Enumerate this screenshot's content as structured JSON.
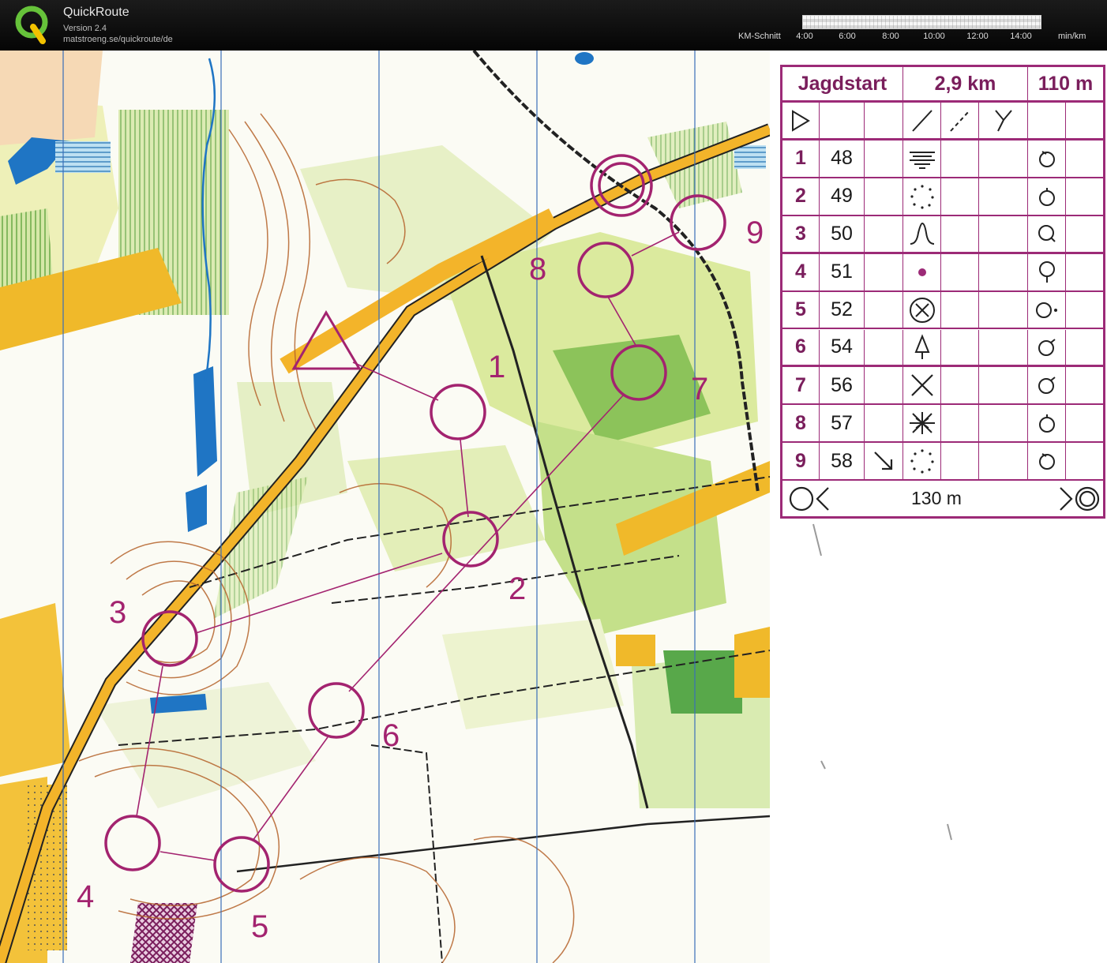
{
  "header": {
    "app_name": "QuickRoute",
    "version": "Version 2.4",
    "url": "matstroeng.se/quickroute/de",
    "pace_label": "KM-Schnitt",
    "pace_ticks": [
      "4:00",
      "6:00",
      "8:00",
      "10:00",
      "12:00",
      "14:00"
    ],
    "pace_unit": "min/km"
  },
  "map": {
    "control_labels": [
      "1",
      "2",
      "3",
      "4",
      "5",
      "6",
      "7",
      "8",
      "9"
    ],
    "course_color": "#a3236f"
  },
  "control_description": {
    "title": "Jagdstart",
    "length": "2,9 km",
    "climb": "110 m",
    "controls": [
      {
        "number": "1",
        "code": "48",
        "feature": "terraces-symbol"
      },
      {
        "number": "2",
        "code": "49",
        "feature": "dotted-circle-symbol"
      },
      {
        "number": "3",
        "code": "50",
        "feature": "spur-symbol"
      },
      {
        "number": "4",
        "code": "51",
        "feature": "dot-symbol"
      },
      {
        "number": "5",
        "code": "52",
        "feature": "circled-x-symbol"
      },
      {
        "number": "6",
        "code": "54",
        "feature": "tree-symbol"
      },
      {
        "number": "7",
        "code": "56",
        "feature": "x-symbol"
      },
      {
        "number": "8",
        "code": "57",
        "feature": "thicket-symbol"
      },
      {
        "number": "9",
        "code": "58",
        "feature": "dotted-circle-symbol",
        "direction": "south-east-arrow"
      }
    ],
    "finish_distance": "130 m"
  }
}
